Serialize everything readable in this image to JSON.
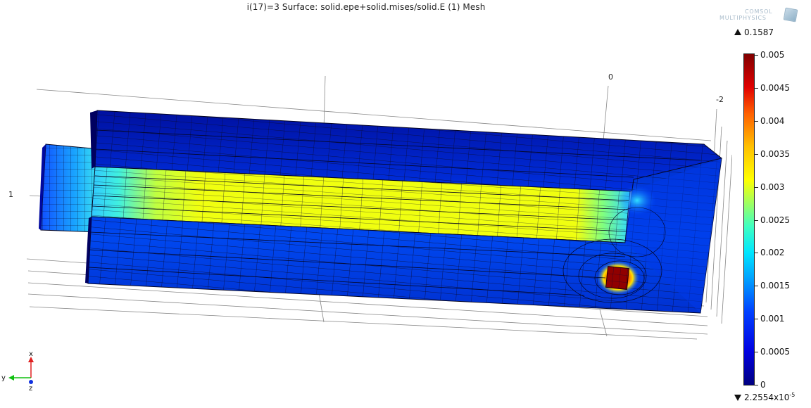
{
  "plot": {
    "title": "i(17)=3   Surface: solid.epe+solid.mises/solid.E (1) Mesh"
  },
  "logo": {
    "line1": "COMSOL",
    "line2": "MULTIPHYSICS",
    "icon": "comsol-cube-icon"
  },
  "legend": {
    "max_value": "0.1587",
    "min_value": "2.2554x10",
    "min_exponent": "-5",
    "ticks": [
      "0.005",
      "0.0045",
      "0.004",
      "0.0035",
      "0.003",
      "0.0025",
      "0.002",
      "0.0015",
      "0.001",
      "0.0005",
      "0"
    ],
    "colormap": "rainbow",
    "range": [
      0,
      0.005
    ]
  },
  "axes": {
    "label_one": "1",
    "label_zero": "0",
    "label_minus_two": "-2"
  },
  "triad": {
    "x": "x",
    "y": "y",
    "z": "z",
    "colors": {
      "x": "#e02020",
      "y": "#10c010",
      "z": "#1030e0"
    }
  }
}
